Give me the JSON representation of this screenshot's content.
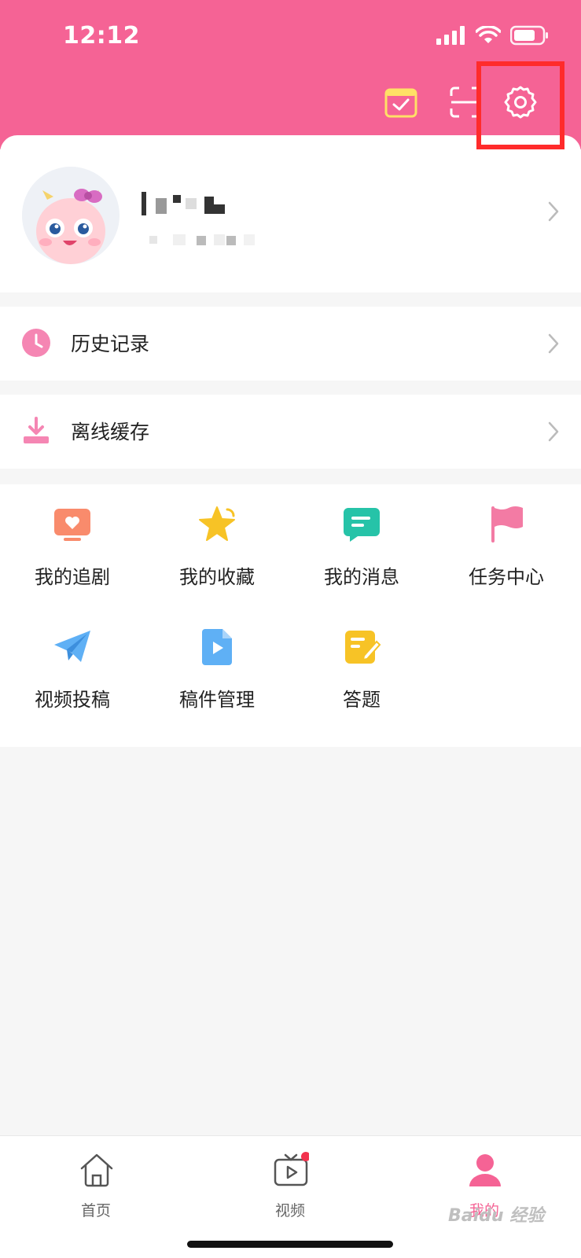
{
  "status_bar": {
    "time": "12:12"
  },
  "header": {
    "icons": [
      "calendar-check-icon",
      "scan-icon",
      "settings-gear-icon"
    ],
    "background_color": "#f56395",
    "highlight_color": "#ff2b2b"
  },
  "menu": {
    "history_label": "历史记录",
    "offline_label": "离线缓存"
  },
  "features": [
    {
      "label": "我的追剧",
      "icon": "tv-heart-icon",
      "color": "#f98b6c"
    },
    {
      "label": "我的收藏",
      "icon": "star-icon",
      "color": "#f7c326"
    },
    {
      "label": "我的消息",
      "icon": "message-icon",
      "color": "#26c3a8"
    },
    {
      "label": "任务中心",
      "icon": "flag-icon",
      "color": "#f37ba4"
    },
    {
      "label": "视频投稿",
      "icon": "paper-plane-icon",
      "color": "#5fb0f5"
    },
    {
      "label": "稿件管理",
      "icon": "video-file-icon",
      "color": "#5fb0f5"
    },
    {
      "label": "答题",
      "icon": "edit-note-icon",
      "color": "#f7c326"
    }
  ],
  "tabbar": {
    "tabs": [
      {
        "label": "首页",
        "icon": "home-icon"
      },
      {
        "label": "视频",
        "icon": "tv-play-icon"
      },
      {
        "label": "我的",
        "icon": "person-icon"
      }
    ],
    "active_color": "#f56395"
  },
  "watermark": {
    "text": "Baidu 经验"
  }
}
